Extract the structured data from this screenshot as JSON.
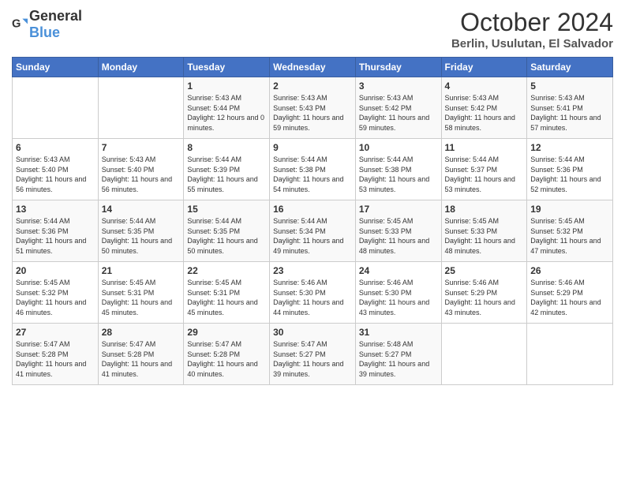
{
  "logo": {
    "text_general": "General",
    "text_blue": "Blue"
  },
  "title": {
    "month": "October 2024",
    "location": "Berlin, Usulutan, El Salvador"
  },
  "days_of_week": [
    "Sunday",
    "Monday",
    "Tuesday",
    "Wednesday",
    "Thursday",
    "Friday",
    "Saturday"
  ],
  "weeks": [
    [
      {
        "day": "",
        "info": ""
      },
      {
        "day": "",
        "info": ""
      },
      {
        "day": "1",
        "info": "Sunrise: 5:43 AM\nSunset: 5:44 PM\nDaylight: 12 hours and 0 minutes."
      },
      {
        "day": "2",
        "info": "Sunrise: 5:43 AM\nSunset: 5:43 PM\nDaylight: 11 hours and 59 minutes."
      },
      {
        "day": "3",
        "info": "Sunrise: 5:43 AM\nSunset: 5:42 PM\nDaylight: 11 hours and 59 minutes."
      },
      {
        "day": "4",
        "info": "Sunrise: 5:43 AM\nSunset: 5:42 PM\nDaylight: 11 hours and 58 minutes."
      },
      {
        "day": "5",
        "info": "Sunrise: 5:43 AM\nSunset: 5:41 PM\nDaylight: 11 hours and 57 minutes."
      }
    ],
    [
      {
        "day": "6",
        "info": "Sunrise: 5:43 AM\nSunset: 5:40 PM\nDaylight: 11 hours and 56 minutes."
      },
      {
        "day": "7",
        "info": "Sunrise: 5:43 AM\nSunset: 5:40 PM\nDaylight: 11 hours and 56 minutes."
      },
      {
        "day": "8",
        "info": "Sunrise: 5:44 AM\nSunset: 5:39 PM\nDaylight: 11 hours and 55 minutes."
      },
      {
        "day": "9",
        "info": "Sunrise: 5:44 AM\nSunset: 5:38 PM\nDaylight: 11 hours and 54 minutes."
      },
      {
        "day": "10",
        "info": "Sunrise: 5:44 AM\nSunset: 5:38 PM\nDaylight: 11 hours and 53 minutes."
      },
      {
        "day": "11",
        "info": "Sunrise: 5:44 AM\nSunset: 5:37 PM\nDaylight: 11 hours and 53 minutes."
      },
      {
        "day": "12",
        "info": "Sunrise: 5:44 AM\nSunset: 5:36 PM\nDaylight: 11 hours and 52 minutes."
      }
    ],
    [
      {
        "day": "13",
        "info": "Sunrise: 5:44 AM\nSunset: 5:36 PM\nDaylight: 11 hours and 51 minutes."
      },
      {
        "day": "14",
        "info": "Sunrise: 5:44 AM\nSunset: 5:35 PM\nDaylight: 11 hours and 50 minutes."
      },
      {
        "day": "15",
        "info": "Sunrise: 5:44 AM\nSunset: 5:35 PM\nDaylight: 11 hours and 50 minutes."
      },
      {
        "day": "16",
        "info": "Sunrise: 5:44 AM\nSunset: 5:34 PM\nDaylight: 11 hours and 49 minutes."
      },
      {
        "day": "17",
        "info": "Sunrise: 5:45 AM\nSunset: 5:33 PM\nDaylight: 11 hours and 48 minutes."
      },
      {
        "day": "18",
        "info": "Sunrise: 5:45 AM\nSunset: 5:33 PM\nDaylight: 11 hours and 48 minutes."
      },
      {
        "day": "19",
        "info": "Sunrise: 5:45 AM\nSunset: 5:32 PM\nDaylight: 11 hours and 47 minutes."
      }
    ],
    [
      {
        "day": "20",
        "info": "Sunrise: 5:45 AM\nSunset: 5:32 PM\nDaylight: 11 hours and 46 minutes."
      },
      {
        "day": "21",
        "info": "Sunrise: 5:45 AM\nSunset: 5:31 PM\nDaylight: 11 hours and 45 minutes."
      },
      {
        "day": "22",
        "info": "Sunrise: 5:45 AM\nSunset: 5:31 PM\nDaylight: 11 hours and 45 minutes."
      },
      {
        "day": "23",
        "info": "Sunrise: 5:46 AM\nSunset: 5:30 PM\nDaylight: 11 hours and 44 minutes."
      },
      {
        "day": "24",
        "info": "Sunrise: 5:46 AM\nSunset: 5:30 PM\nDaylight: 11 hours and 43 minutes."
      },
      {
        "day": "25",
        "info": "Sunrise: 5:46 AM\nSunset: 5:29 PM\nDaylight: 11 hours and 43 minutes."
      },
      {
        "day": "26",
        "info": "Sunrise: 5:46 AM\nSunset: 5:29 PM\nDaylight: 11 hours and 42 minutes."
      }
    ],
    [
      {
        "day": "27",
        "info": "Sunrise: 5:47 AM\nSunset: 5:28 PM\nDaylight: 11 hours and 41 minutes."
      },
      {
        "day": "28",
        "info": "Sunrise: 5:47 AM\nSunset: 5:28 PM\nDaylight: 11 hours and 41 minutes."
      },
      {
        "day": "29",
        "info": "Sunrise: 5:47 AM\nSunset: 5:28 PM\nDaylight: 11 hours and 40 minutes."
      },
      {
        "day": "30",
        "info": "Sunrise: 5:47 AM\nSunset: 5:27 PM\nDaylight: 11 hours and 39 minutes."
      },
      {
        "day": "31",
        "info": "Sunrise: 5:48 AM\nSunset: 5:27 PM\nDaylight: 11 hours and 39 minutes."
      },
      {
        "day": "",
        "info": ""
      },
      {
        "day": "",
        "info": ""
      }
    ]
  ]
}
